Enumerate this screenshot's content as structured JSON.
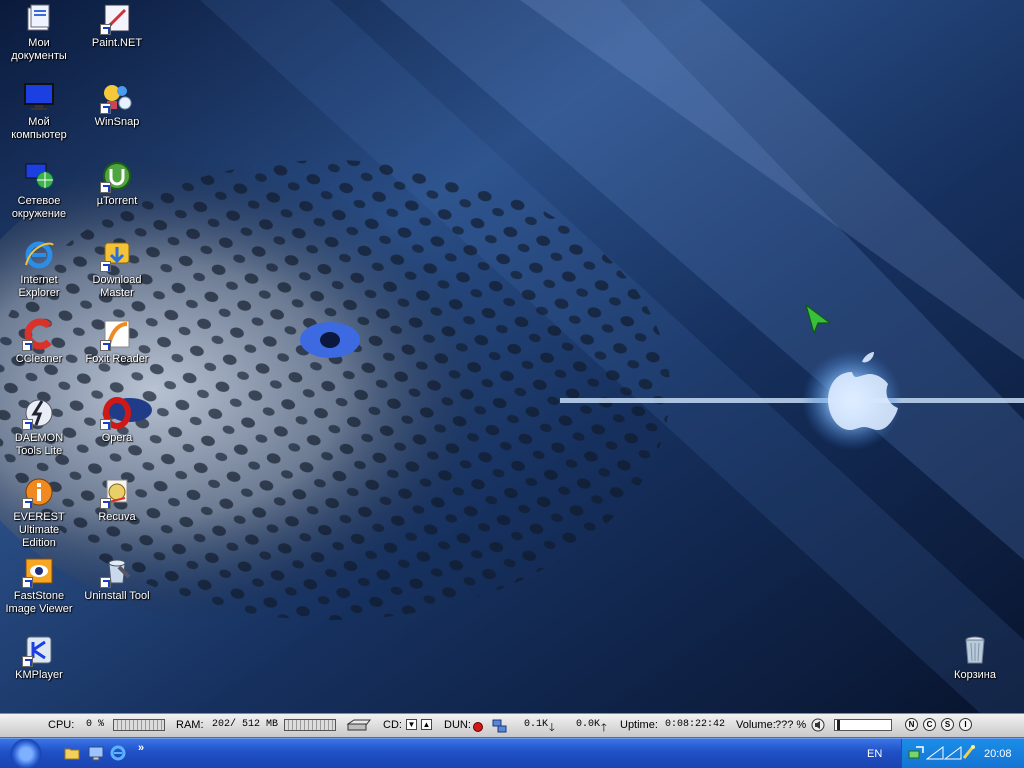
{
  "desktop_icons": [
    {
      "id": "my-documents",
      "label": "Мои документы",
      "icon": "folder-documents-icon",
      "shortcut": false
    },
    {
      "id": "paint-net",
      "label": "Paint.NET",
      "icon": "paint-net-icon",
      "shortcut": true
    },
    {
      "id": "my-computer",
      "label": "Мой компьютер",
      "icon": "monitor-icon",
      "shortcut": false
    },
    {
      "id": "winsnap",
      "label": "WinSnap",
      "icon": "winsnap-icon",
      "shortcut": true
    },
    {
      "id": "network",
      "label": "Сетевое окружение",
      "icon": "network-globe-icon",
      "shortcut": false
    },
    {
      "id": "utorrent",
      "label": "µTorrent",
      "icon": "utorrent-icon",
      "shortcut": true
    },
    {
      "id": "ie",
      "label": "Internet Explorer",
      "icon": "internet-explorer-icon",
      "shortcut": false
    },
    {
      "id": "download-master",
      "label": "Download Master",
      "icon": "download-master-icon",
      "shortcut": true
    },
    {
      "id": "ccleaner",
      "label": "CCleaner",
      "icon": "ccleaner-icon",
      "shortcut": true
    },
    {
      "id": "foxit",
      "label": "Foxit Reader",
      "icon": "foxit-reader-icon",
      "shortcut": true
    },
    {
      "id": "daemon",
      "label": "DAEMON Tools Lite",
      "icon": "daemon-tools-icon",
      "shortcut": true
    },
    {
      "id": "opera",
      "label": "Opera",
      "icon": "opera-icon",
      "shortcut": true
    },
    {
      "id": "everest",
      "label": "EVEREST Ultimate Edition",
      "icon": "everest-icon",
      "shortcut": true
    },
    {
      "id": "recuva",
      "label": "Recuva",
      "icon": "recuva-icon",
      "shortcut": true
    },
    {
      "id": "faststone",
      "label": "FastStone Image Viewer",
      "icon": "faststone-icon",
      "shortcut": true
    },
    {
      "id": "uninstall-tool",
      "label": "Uninstall Tool",
      "icon": "uninstall-tool-icon",
      "shortcut": true
    },
    {
      "id": "kmplayer",
      "label": "KMPlayer",
      "icon": "kmplayer-icon",
      "shortcut": true
    }
  ],
  "recycle_bin": {
    "label": "Корзина",
    "icon": "recycle-bin-icon"
  },
  "statusbar": {
    "cpu_label": "CPU:",
    "cpu_value": "0 %",
    "ram_label": "RAM:",
    "ram_value": "202/ 512 MB",
    "cd_label": "CD:",
    "dun_label": "DUN:",
    "download": "0.1K",
    "upload": "0.0K",
    "uptime_label": "Uptime:",
    "uptime_value": "0:08:22:42",
    "volume_label": "Volume:",
    "volume_value": "??? %",
    "buttons": [
      "N",
      "C",
      "S",
      "I"
    ]
  },
  "taskbar": {
    "language": "EN",
    "clock": "20:08",
    "quick_launch": [
      "folder-icon",
      "desktop-icon",
      "internet-explorer-icon"
    ],
    "overflow": "»"
  },
  "colors": {
    "taskbar": "#1f50c6",
    "tray": "#1473d3",
    "statusbar": "#d8d8d8",
    "wallpaper": "#0e2a5a"
  }
}
